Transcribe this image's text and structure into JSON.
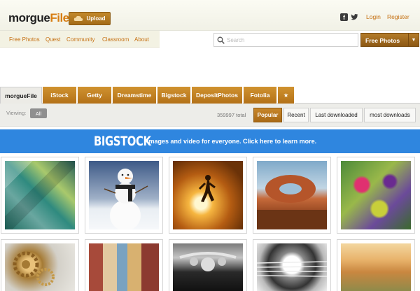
{
  "header": {
    "logo_text_1": "morgue",
    "logo_text_2": "File",
    "upload_label": "Upload",
    "login_label": "Login",
    "register_label": "Register"
  },
  "nav": {
    "items": [
      "Free Photos",
      "Quest",
      "Community",
      "Classroom",
      "About"
    ]
  },
  "search": {
    "placeholder": "Search",
    "select_value": "Free Photos"
  },
  "tabs": [
    "morgueFile",
    "iStock",
    "Getty",
    "Dreamstime",
    "Bigstock",
    "DepositPhotos",
    "Fotolia",
    "★"
  ],
  "viewbar": {
    "viewing_label": "Viewing:",
    "all_label": "All",
    "total": "359997 total",
    "sort_options": [
      "Popular",
      "Recent",
      "Last downloaded",
      "most downloads"
    ]
  },
  "banner": {
    "logo": "BIGSTOCK",
    "text": "Images and video for everyone. Click here to learn more."
  },
  "photos": [
    {
      "name": "abstract-glass-photo"
    },
    {
      "name": "snowman-photo"
    },
    {
      "name": "runner-sunset-photo"
    },
    {
      "name": "rock-formation-photo"
    },
    {
      "name": "flowers-painting-photo"
    },
    {
      "name": "clock-gears-photo"
    },
    {
      "name": "street-buildings-photo"
    },
    {
      "name": "motorcycle-photo"
    },
    {
      "name": "guitar-photo"
    },
    {
      "name": "landscape-painting-photo"
    }
  ],
  "colors": {
    "accent": "#c56f10",
    "tab_orange": "#c07d22",
    "banner_blue": "#2f86df"
  }
}
